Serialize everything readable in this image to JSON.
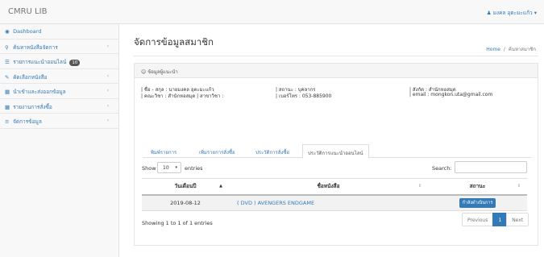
{
  "app": {
    "brand": "CMRU LIB"
  },
  "user_menu": {
    "label": "มงคล อุตะมะแก้ว",
    "icon": "user-icon"
  },
  "sidebar": {
    "items": [
      {
        "label": "Dashboard",
        "icon": "dashboard-icon",
        "has_submenu": false
      },
      {
        "label": "ค้นหาหนังสือจัดการ",
        "icon": "search-icon",
        "has_submenu": true
      },
      {
        "label": "รายการแนะนำออนไลน์",
        "icon": "list-icon",
        "has_submenu": false,
        "badge": "10"
      },
      {
        "label": "คัดเลือกหนังสือ",
        "icon": "edit-icon",
        "has_submenu": true
      },
      {
        "label": "นำเข้าและส่งออกข้อมูล",
        "icon": "table-icon",
        "has_submenu": true
      },
      {
        "label": "รายงานการสั่งซื้อ",
        "icon": "chart-icon",
        "has_submenu": true
      },
      {
        "label": "จัดการข้อมูล",
        "icon": "settings-icon",
        "has_submenu": true
      }
    ]
  },
  "page": {
    "title": "จัดการข้อมูลสมาชิก",
    "breadcrumb": {
      "home": "Home",
      "current": "ค้นหาสมาชิก"
    }
  },
  "panel": {
    "heading": "ข้อมูลผู้แนะนำ",
    "heading_icon": "user-outline-icon",
    "col1_line1": "| ชื่อ - สกุล : นายมงคล อุตะมะแก้ว",
    "col1_line2": "| คณะวิชา : สำนักหอสมุด | สาขาวิชา :",
    "col2_line1": "| สถานะ : บุคลากร",
    "col2_line2": "| เบอร์โทร : 053-885900",
    "col3_line1": "| สังกัด : สำนักหอสมุด",
    "col3_line2": "| email : mongkon.uta@gmail.com"
  },
  "tabs": [
    {
      "label": "พิมพ์รายการ",
      "active": false
    },
    {
      "label": "เพิ่มรายการสั่งซื้อ",
      "active": false
    },
    {
      "label": "ประวัติการสั่งซื้อ",
      "active": false
    },
    {
      "label": "ประวัติการแนะนำออนไลน์",
      "active": true
    }
  ],
  "table_controls": {
    "show_label": "Show",
    "page_size": "10",
    "entries_label": "entries",
    "search_label": "Search:",
    "search_value": ""
  },
  "table": {
    "headers": [
      "วันเดือนปี",
      "ชื่อหนังสือ",
      "สถานะ"
    ],
    "rows": [
      {
        "date": "2019-08-12",
        "title": "( DVD ) AVENGERS ENDGAME",
        "status": "กำลังดำเนินการ"
      }
    ]
  },
  "footer": {
    "info": "Showing 1 to 1 of 1 entries",
    "prev": "Previous",
    "page": "1",
    "next": "Next"
  },
  "colors": {
    "accent": "#337ab7",
    "sidebar_bg": "#f8f8f8",
    "row_bg": "#f2f2f2"
  }
}
